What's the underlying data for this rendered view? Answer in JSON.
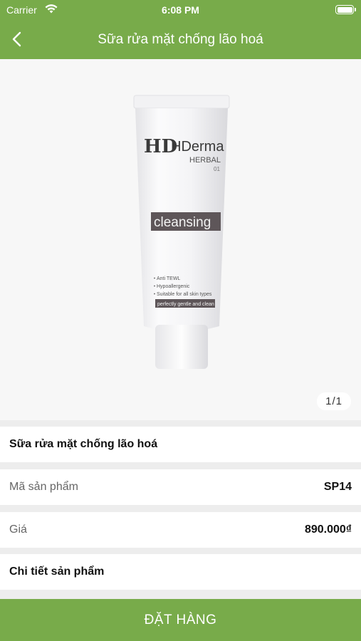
{
  "status_bar": {
    "carrier": "Carrier",
    "time": "6:08 PM",
    "wifi_icon": "wifi-icon",
    "battery_icon": "battery-icon"
  },
  "nav": {
    "title": "Sữa rửa mặt chống lão hoá",
    "back_icon": "chevron-left-icon"
  },
  "product_image": {
    "brand": "HDerma",
    "brand_line": "HERBAL",
    "brand_number": "01",
    "band_text": "cleansing",
    "bullets": [
      "Anti TEWL",
      "Hypoallergenic",
      "Suitable for all skin types"
    ],
    "tagline": "perfectly gentle and clean",
    "page_indicator": "1/1"
  },
  "details": {
    "product_name": "Sữa rửa mặt chống lão hoá",
    "code_label": "Mã sản phẩm",
    "code_value": "SP14",
    "price_label": "Giá",
    "price_value": "890.000₫",
    "details_label": "Chi tiết sản phẩm"
  },
  "order_button_label": "ĐẶT HÀNG",
  "colors": {
    "accent": "#78ab4a",
    "background": "#ededed"
  }
}
